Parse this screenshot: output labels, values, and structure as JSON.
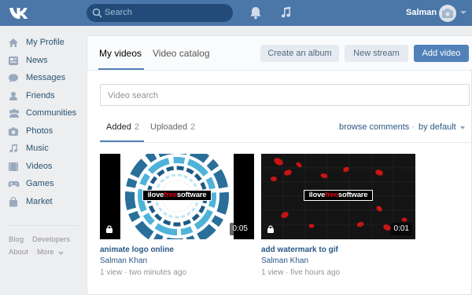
{
  "header": {
    "search_placeholder": "Search",
    "username": "Salman"
  },
  "sidebar": {
    "items": [
      {
        "label": "My Profile",
        "icon": "home-icon"
      },
      {
        "label": "News",
        "icon": "news-icon"
      },
      {
        "label": "Messages",
        "icon": "messages-icon"
      },
      {
        "label": "Friends",
        "icon": "friend-icon"
      },
      {
        "label": "Communities",
        "icon": "communities-icon"
      },
      {
        "label": "Photos",
        "icon": "camera-icon"
      },
      {
        "label": "Music",
        "icon": "music-icon"
      },
      {
        "label": "Videos",
        "icon": "film-icon"
      },
      {
        "label": "Games",
        "icon": "gamepad-icon"
      },
      {
        "label": "Market",
        "icon": "bag-icon"
      }
    ],
    "footer": {
      "blog": "Blog",
      "developers": "Developers",
      "about": "About",
      "more": "More"
    }
  },
  "main": {
    "tabs": {
      "my_videos": "My videos",
      "video_catalog": "Video catalog"
    },
    "buttons": {
      "create_album": "Create an album",
      "new_stream": "New stream",
      "add_video": "Add video"
    },
    "video_search_placeholder": "Video search",
    "subtabs": {
      "added": "Added",
      "added_count": "2",
      "uploaded": "Uploaded",
      "uploaded_count": "2"
    },
    "browse_comments": "browse comments",
    "sort_label": "by default",
    "videos": [
      {
        "title": "animate logo online",
        "author": "Salman Khan",
        "views": "1 view",
        "time": "two minutes ago",
        "duration": "0:05",
        "watermark_pre": "ilove",
        "watermark_mid": "free",
        "watermark_post": "software"
      },
      {
        "title": "add watermark to gif",
        "author": "Salman Khan",
        "views": "1 view",
        "time": "five hours ago",
        "duration": "0:01",
        "watermark_pre": "ilove",
        "watermark_mid": "free",
        "watermark_post": "software"
      }
    ]
  },
  "colors": {
    "header_bg": "#4a76a8",
    "accent": "#5181b8",
    "link": "#2a5885"
  }
}
